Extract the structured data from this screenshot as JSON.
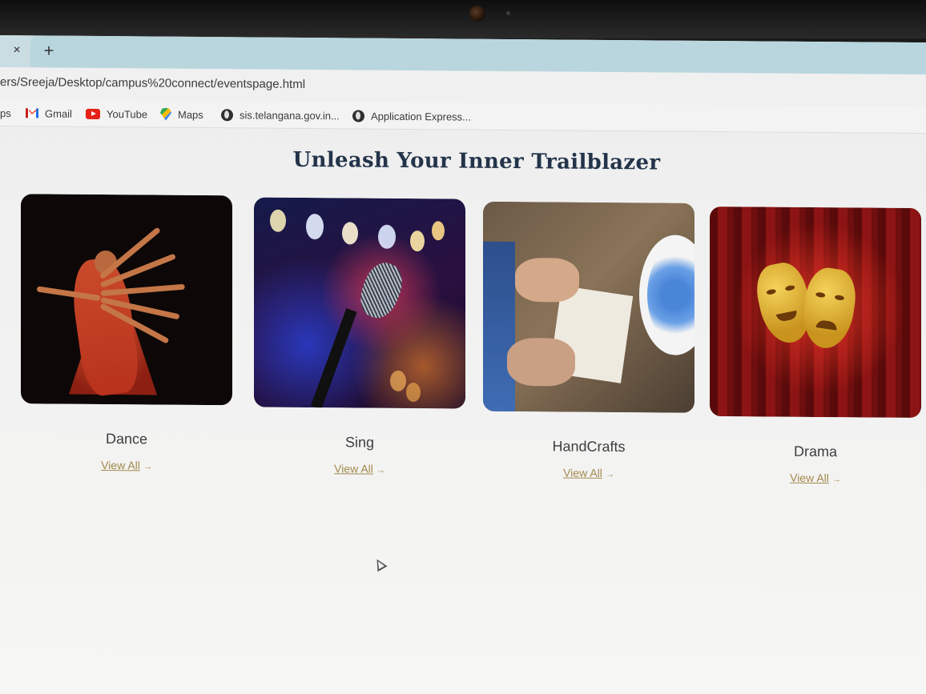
{
  "browser": {
    "tab_close_label": "×",
    "new_tab_label": "+",
    "url": "ers/Sreeja/Desktop/campus%20connect/eventspage.html",
    "bookmarks": [
      {
        "label": "ps",
        "icon": "apps-icon"
      },
      {
        "label": "Gmail",
        "icon": "gmail-icon"
      },
      {
        "label": "YouTube",
        "icon": "youtube-icon"
      },
      {
        "label": "Maps",
        "icon": "maps-icon"
      },
      {
        "label": "sis.telangana.gov.in...",
        "icon": "globe-icon"
      },
      {
        "label": "Application Express...",
        "icon": "globe-icon"
      }
    ]
  },
  "page": {
    "heading": "Unleash Your Inner Trailblazer",
    "cards": [
      {
        "title": "Dance",
        "link": "View All",
        "arrow": "→",
        "image": "dance-photo"
      },
      {
        "title": "Sing",
        "link": "View All",
        "arrow": "→",
        "image": "microphone-photo"
      },
      {
        "title": "HandCrafts",
        "link": "View All",
        "arrow": "→",
        "image": "handcrafts-photo"
      },
      {
        "title": "Drama",
        "link": "View All",
        "arrow": "→",
        "image": "theatre-masks-photo"
      }
    ],
    "link_color": "#a38a4e",
    "heading_color": "#23344a"
  }
}
